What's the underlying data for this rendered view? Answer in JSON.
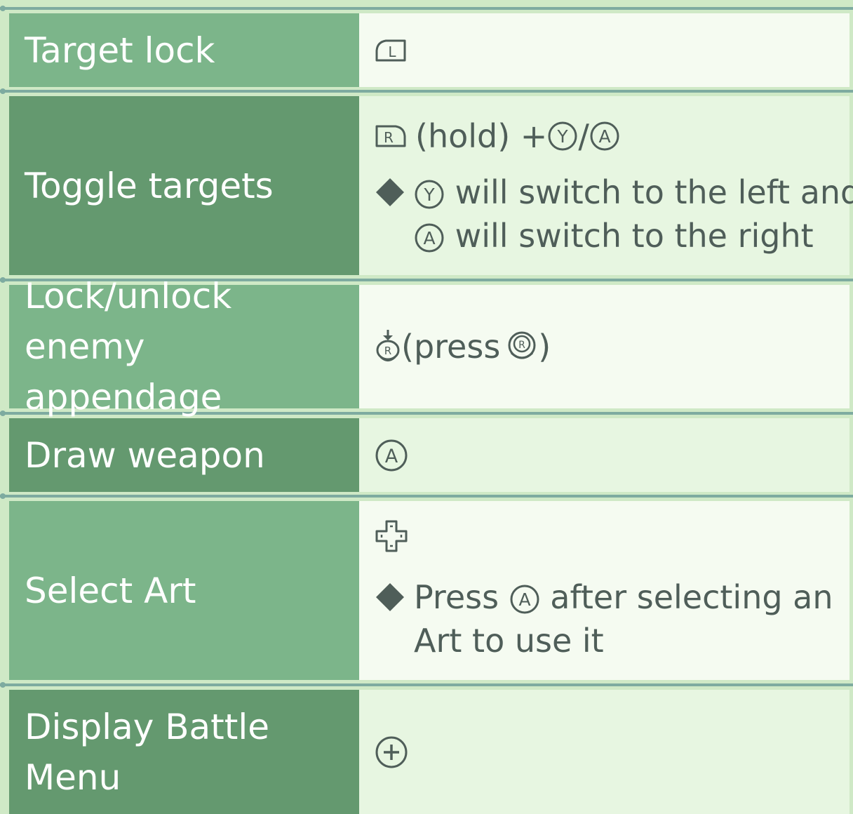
{
  "rows": [
    {
      "label": "Target lock",
      "control_icon": "l-button-icon"
    },
    {
      "label": "Toggle targets",
      "control": {
        "icon1": "r-button-icon",
        "text1": "(hold) + ",
        "icon2": "y-button-icon",
        "text2": "/",
        "icon3": "a-button-icon"
      },
      "note": {
        "icon1": "y-button-icon",
        "line1_text": " will switch to the left and",
        "icon2": "a-button-icon",
        "line2_text": " will switch to the right"
      }
    },
    {
      "label_line1": "Lock/unlock enemy",
      "label_line2": "appendage",
      "control": {
        "icon1": "r-stick-press-icon",
        "text1": " (press ",
        "icon2": "r-stick-icon",
        "text2": ")"
      }
    },
    {
      "label": "Draw weapon",
      "control_icon": "a-button-icon"
    },
    {
      "label": "Select Art",
      "control_icon": "d-pad-icon",
      "note": {
        "text_before": "Press ",
        "icon": "a-button-icon",
        "text_after": " after selecting an",
        "line2_text": "Art to use it"
      }
    },
    {
      "label_line1": "Display Battle",
      "label_line2": "Menu",
      "control_icon": "plus-button-icon"
    }
  ],
  "colors": {
    "label_light": "#7cb58a",
    "label_dark": "#64996f",
    "cell_white": "#f5fbf1",
    "cell_mint": "#e7f6e1",
    "separator": "#7eaba0",
    "text_dark": "#4f5e59",
    "text_light": "#ffffff"
  }
}
